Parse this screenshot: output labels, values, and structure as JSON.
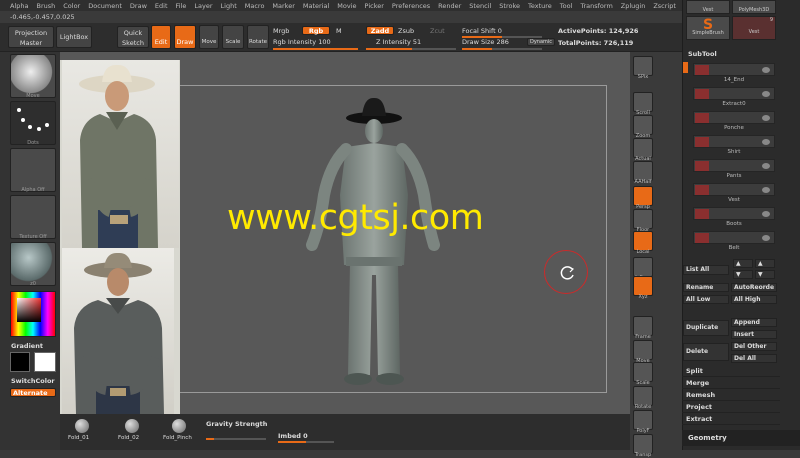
{
  "menu": [
    "Alpha",
    "Brush",
    "Color",
    "Document",
    "Draw",
    "Edit",
    "File",
    "Layer",
    "Light",
    "Macro",
    "Marker",
    "Material",
    "Movie",
    "Picker",
    "Preferences",
    "Render",
    "Stencil",
    "Stroke",
    "Texture",
    "Tool",
    "Transform",
    "Zplugin",
    "Zscript"
  ],
  "coords": "-0.465,-0.457,0.025",
  "toolbar": {
    "projection_master": "Projection Master",
    "lightbox": "LightBox",
    "quick_sketch": "Quick Sketch",
    "edit": "Edit",
    "draw": "Draw",
    "move": "Move",
    "scale": "Scale",
    "rotate": "Rotate",
    "mrgb": "Mrgb",
    "rgb": "Rgb",
    "m": "M",
    "rgb_intensity": "Rgb Intensity 100",
    "zadd": "Zadd",
    "zsub": "Zsub",
    "zcut": "Zcut",
    "z_intensity": "Z Intensity 51",
    "focal_shift": "Focal Shift 0",
    "draw_size": "Draw Size 286",
    "dynamic": "Dynamic",
    "active_points": "ActivePoints: 124,926",
    "total_points": "TotalPoints: 726,119"
  },
  "left": {
    "move": "Move",
    "dots": "Dots",
    "alpha_off": "Alpha Off",
    "texture_off": "Texture Off",
    "material": "z0",
    "gradient": "Gradient",
    "switch_color": "SwitchColor",
    "alternate": "Alternate"
  },
  "watermark": "www.cgtsj.com",
  "right_rail": [
    "SPix",
    "Scroll",
    "Zoom",
    "Actual",
    "AAHalf",
    "Persp",
    "Floor",
    "Local",
    "L.Sym",
    "Xyz",
    "Frame",
    "Move",
    "Scale",
    "Rotate",
    "PolyF",
    "Transp"
  ],
  "subtool": {
    "tiles_top": [
      "Vest",
      "PolyMesh3D"
    ],
    "tiles_bottom": [
      "SimpleBrush",
      "Vest"
    ],
    "tile_number": "9",
    "title": "SubTool",
    "items": [
      "14_End",
      "Extract0",
      "Ponche",
      "Shirt",
      "Pants",
      "Vest",
      "Boots",
      "Belt"
    ],
    "list_all": "List All",
    "rename": "Rename",
    "auto_reorder": "AutoReorde",
    "all_low": "All Low",
    "all_high": "All High",
    "duplicate": "Duplicate",
    "append": "Append",
    "insert": "Insert",
    "delete": "Delete",
    "del_other": "Del Other",
    "del_all": "Del All",
    "split": "Split",
    "merge": "Merge",
    "remesh": "Remesh",
    "project": "Project",
    "extract": "Extract",
    "geometry": "Geometry"
  },
  "bottom": {
    "fold1": "Fold_01",
    "fold2": "Fold_02",
    "fold_pinch": "Fold_Pinch",
    "gravity": "Gravity Strength",
    "imbed": "Imbed 0"
  },
  "colors": {
    "accent": "#e86a17",
    "watermark": "#ffea00"
  }
}
